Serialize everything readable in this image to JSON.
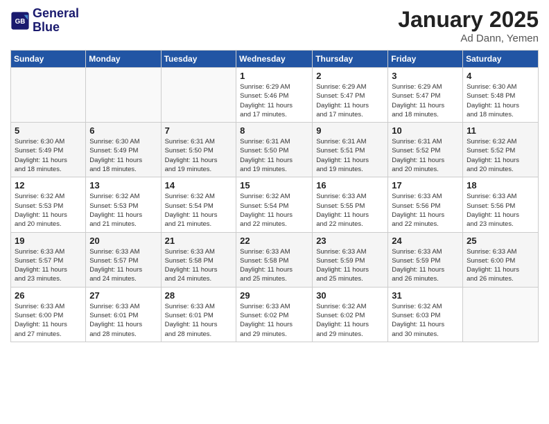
{
  "header": {
    "logo_line1": "General",
    "logo_line2": "Blue",
    "month": "January 2025",
    "location": "Ad Dann, Yemen"
  },
  "days_of_week": [
    "Sunday",
    "Monday",
    "Tuesday",
    "Wednesday",
    "Thursday",
    "Friday",
    "Saturday"
  ],
  "weeks": [
    [
      {
        "day": "",
        "info": ""
      },
      {
        "day": "",
        "info": ""
      },
      {
        "day": "",
        "info": ""
      },
      {
        "day": "1",
        "info": "Sunrise: 6:29 AM\nSunset: 5:46 PM\nDaylight: 11 hours\nand 17 minutes."
      },
      {
        "day": "2",
        "info": "Sunrise: 6:29 AM\nSunset: 5:47 PM\nDaylight: 11 hours\nand 17 minutes."
      },
      {
        "day": "3",
        "info": "Sunrise: 6:29 AM\nSunset: 5:47 PM\nDaylight: 11 hours\nand 18 minutes."
      },
      {
        "day": "4",
        "info": "Sunrise: 6:30 AM\nSunset: 5:48 PM\nDaylight: 11 hours\nand 18 minutes."
      }
    ],
    [
      {
        "day": "5",
        "info": "Sunrise: 6:30 AM\nSunset: 5:49 PM\nDaylight: 11 hours\nand 18 minutes."
      },
      {
        "day": "6",
        "info": "Sunrise: 6:30 AM\nSunset: 5:49 PM\nDaylight: 11 hours\nand 18 minutes."
      },
      {
        "day": "7",
        "info": "Sunrise: 6:31 AM\nSunset: 5:50 PM\nDaylight: 11 hours\nand 19 minutes."
      },
      {
        "day": "8",
        "info": "Sunrise: 6:31 AM\nSunset: 5:50 PM\nDaylight: 11 hours\nand 19 minutes."
      },
      {
        "day": "9",
        "info": "Sunrise: 6:31 AM\nSunset: 5:51 PM\nDaylight: 11 hours\nand 19 minutes."
      },
      {
        "day": "10",
        "info": "Sunrise: 6:31 AM\nSunset: 5:52 PM\nDaylight: 11 hours\nand 20 minutes."
      },
      {
        "day": "11",
        "info": "Sunrise: 6:32 AM\nSunset: 5:52 PM\nDaylight: 11 hours\nand 20 minutes."
      }
    ],
    [
      {
        "day": "12",
        "info": "Sunrise: 6:32 AM\nSunset: 5:53 PM\nDaylight: 11 hours\nand 20 minutes."
      },
      {
        "day": "13",
        "info": "Sunrise: 6:32 AM\nSunset: 5:53 PM\nDaylight: 11 hours\nand 21 minutes."
      },
      {
        "day": "14",
        "info": "Sunrise: 6:32 AM\nSunset: 5:54 PM\nDaylight: 11 hours\nand 21 minutes."
      },
      {
        "day": "15",
        "info": "Sunrise: 6:32 AM\nSunset: 5:54 PM\nDaylight: 11 hours\nand 22 minutes."
      },
      {
        "day": "16",
        "info": "Sunrise: 6:33 AM\nSunset: 5:55 PM\nDaylight: 11 hours\nand 22 minutes."
      },
      {
        "day": "17",
        "info": "Sunrise: 6:33 AM\nSunset: 5:56 PM\nDaylight: 11 hours\nand 22 minutes."
      },
      {
        "day": "18",
        "info": "Sunrise: 6:33 AM\nSunset: 5:56 PM\nDaylight: 11 hours\nand 23 minutes."
      }
    ],
    [
      {
        "day": "19",
        "info": "Sunrise: 6:33 AM\nSunset: 5:57 PM\nDaylight: 11 hours\nand 23 minutes."
      },
      {
        "day": "20",
        "info": "Sunrise: 6:33 AM\nSunset: 5:57 PM\nDaylight: 11 hours\nand 24 minutes."
      },
      {
        "day": "21",
        "info": "Sunrise: 6:33 AM\nSunset: 5:58 PM\nDaylight: 11 hours\nand 24 minutes."
      },
      {
        "day": "22",
        "info": "Sunrise: 6:33 AM\nSunset: 5:58 PM\nDaylight: 11 hours\nand 25 minutes."
      },
      {
        "day": "23",
        "info": "Sunrise: 6:33 AM\nSunset: 5:59 PM\nDaylight: 11 hours\nand 25 minutes."
      },
      {
        "day": "24",
        "info": "Sunrise: 6:33 AM\nSunset: 5:59 PM\nDaylight: 11 hours\nand 26 minutes."
      },
      {
        "day": "25",
        "info": "Sunrise: 6:33 AM\nSunset: 6:00 PM\nDaylight: 11 hours\nand 26 minutes."
      }
    ],
    [
      {
        "day": "26",
        "info": "Sunrise: 6:33 AM\nSunset: 6:00 PM\nDaylight: 11 hours\nand 27 minutes."
      },
      {
        "day": "27",
        "info": "Sunrise: 6:33 AM\nSunset: 6:01 PM\nDaylight: 11 hours\nand 28 minutes."
      },
      {
        "day": "28",
        "info": "Sunrise: 6:33 AM\nSunset: 6:01 PM\nDaylight: 11 hours\nand 28 minutes."
      },
      {
        "day": "29",
        "info": "Sunrise: 6:33 AM\nSunset: 6:02 PM\nDaylight: 11 hours\nand 29 minutes."
      },
      {
        "day": "30",
        "info": "Sunrise: 6:32 AM\nSunset: 6:02 PM\nDaylight: 11 hours\nand 29 minutes."
      },
      {
        "day": "31",
        "info": "Sunrise: 6:32 AM\nSunset: 6:03 PM\nDaylight: 11 hours\nand 30 minutes."
      },
      {
        "day": "",
        "info": ""
      }
    ]
  ]
}
